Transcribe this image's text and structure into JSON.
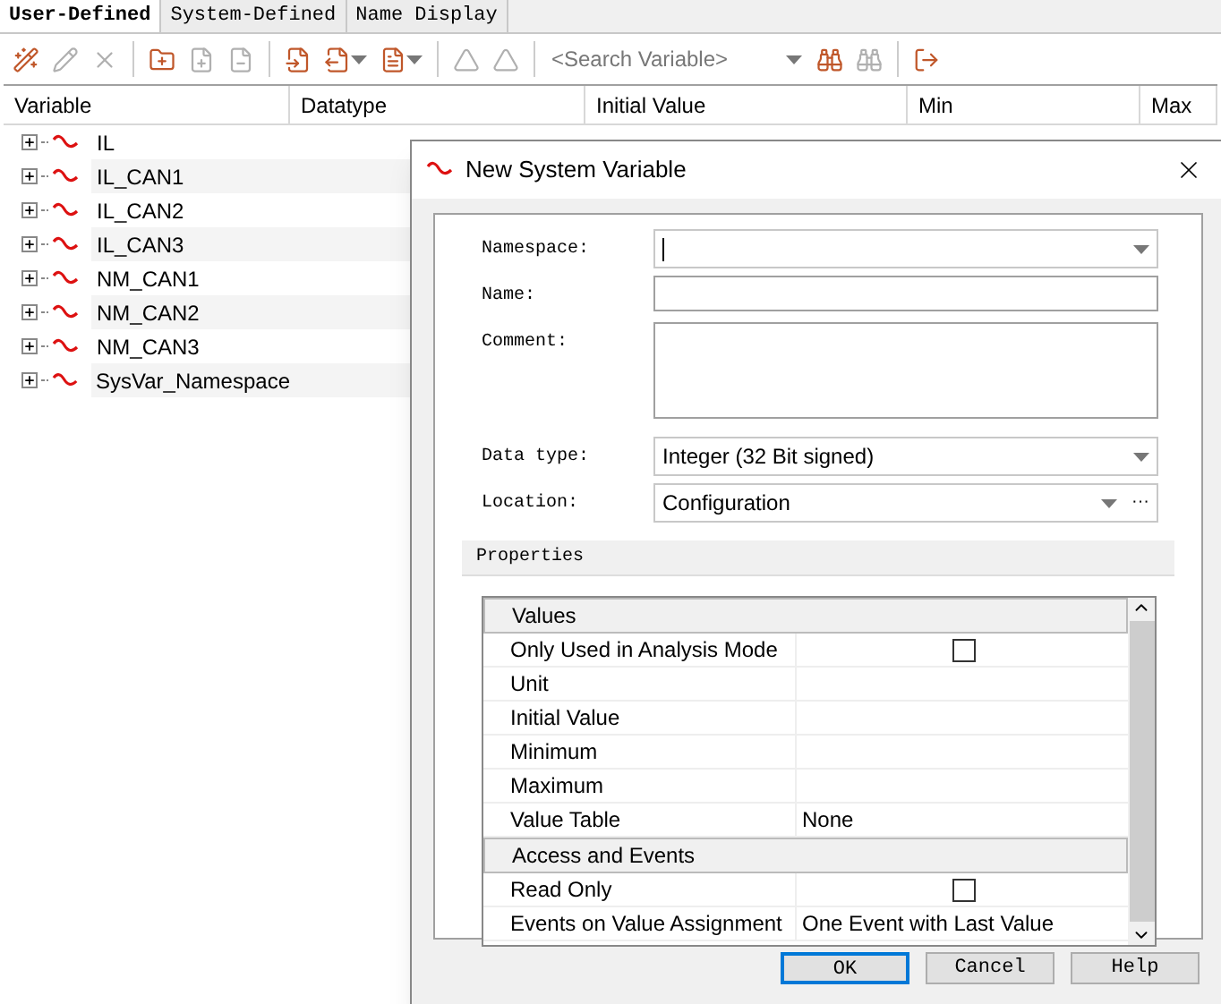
{
  "tabs": [
    {
      "label": "User-Defined",
      "selected": true
    },
    {
      "label": "System-Defined",
      "selected": false
    },
    {
      "label": "Name Display",
      "selected": false
    }
  ],
  "toolbar": {
    "search": {
      "placeholder": "<Search Variable>"
    }
  },
  "table": {
    "columns": [
      "Variable",
      "Datatype",
      "Initial Value",
      "Min",
      "Max"
    ],
    "rows": [
      {
        "name": "IL",
        "expanded": false
      },
      {
        "name": "IL_CAN1",
        "expanded": false
      },
      {
        "name": "IL_CAN2",
        "expanded": false
      },
      {
        "name": "IL_CAN3",
        "expanded": false
      },
      {
        "name": "NM_CAN1",
        "expanded": false
      },
      {
        "name": "NM_CAN2",
        "expanded": false
      },
      {
        "name": "NM_CAN3",
        "expanded": false
      },
      {
        "name": "SysVar_Namespace",
        "expanded": false
      }
    ]
  },
  "dialog": {
    "title": "New System Variable",
    "fields": [
      {
        "label": "Namespace:",
        "kind": "combo"
      },
      {
        "label": "Name:",
        "kind": "text"
      },
      {
        "label": "Comment:",
        "kind": "multiline"
      },
      {
        "label": "Data type:",
        "kind": "combo",
        "value": "Integer (32 Bit signed)"
      },
      {
        "label": "Location:",
        "kind": "combo-more",
        "value": "Configuration",
        "more_label": "···"
      }
    ],
    "properties_title": "Properties",
    "property_rows": [
      {
        "kind": "category",
        "label": "Values"
      },
      {
        "kind": "checkbox",
        "label": "Only Used in Analysis Mode",
        "checked": false
      },
      {
        "kind": "text",
        "label": "Unit"
      },
      {
        "kind": "text",
        "label": "Initial Value"
      },
      {
        "kind": "text",
        "label": "Minimum"
      },
      {
        "kind": "text",
        "label": "Maximum"
      },
      {
        "kind": "text",
        "label": "Value Table",
        "value": "None"
      },
      {
        "kind": "category",
        "label": "Access and Events"
      },
      {
        "kind": "checkbox",
        "label": "Read Only",
        "checked": false
      },
      {
        "kind": "text",
        "label": "Events on Value Assignment",
        "value": "One Event with Last Value"
      }
    ],
    "buttons": [
      {
        "label": "OK",
        "default": true
      },
      {
        "label": "Cancel",
        "default": false
      },
      {
        "label": "Help",
        "default": false
      }
    ]
  }
}
